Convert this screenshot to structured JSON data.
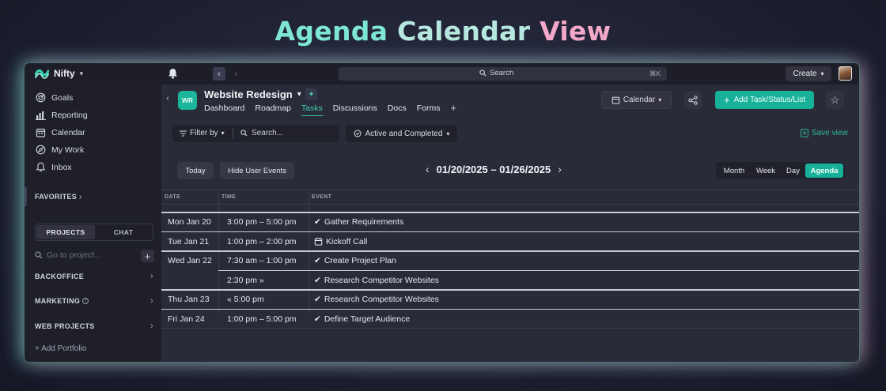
{
  "hero": {
    "word1": "Agenda",
    "word2": "Calendar",
    "word3": "View"
  },
  "topbar": {
    "brand": "Nifty",
    "search_label": "Search",
    "search_shortcut": "⌘K",
    "create_label": "Create"
  },
  "sidebar": {
    "nav": [
      {
        "label": "Goals",
        "icon": "goals-icon"
      },
      {
        "label": "Reporting",
        "icon": "chart-icon"
      },
      {
        "label": "Calendar",
        "icon": "calendar-icon"
      },
      {
        "label": "My Work",
        "icon": "compass-icon"
      },
      {
        "label": "Inbox",
        "icon": "bell-icon"
      }
    ],
    "favorites": "FAVORITES",
    "tab_projects": "PROJECTS",
    "tab_chat": "CHAT",
    "goto_placeholder": "Go to project...",
    "groups": [
      "BACKOFFICE",
      "MARKETING",
      "WEB PROJECTS"
    ],
    "add_portfolio": "+ Add Portfolio"
  },
  "project": {
    "badge": "WR",
    "title": "Website Redesign",
    "tabs": [
      "Dashboard",
      "Roadmap",
      "Tasks",
      "Discussions",
      "Docs",
      "Forms"
    ],
    "active_tab": "Tasks",
    "view_label": "Calendar",
    "add_task_label": "Add Task/Status/List"
  },
  "toolbar": {
    "filter_label": "Filter by",
    "search_placeholder": "Search...",
    "status_filter": "Active and Completed",
    "save_view": "Save view",
    "today": "Today",
    "hide_user_events": "Hide User Events",
    "date_range": "01/20/2025 – 01/26/2025",
    "views": [
      "Month",
      "Week",
      "Day",
      "Agenda"
    ],
    "active_view": "Agenda"
  },
  "agenda": {
    "headers": {
      "date": "DATE",
      "time": "TIME",
      "event": "EVENT"
    },
    "rows": [
      {
        "date": "Mon Jan 20",
        "time": "3:00 pm – 5:00 pm",
        "event": "Gather Requirements",
        "icon": "check-icon"
      },
      {
        "date": "Tue Jan 21",
        "time": "1:00 pm – 2:00 pm",
        "event": "Kickoff Call",
        "icon": "calendar-icon"
      },
      {
        "date": "Wed Jan 22",
        "time": "7:30 am – 1:00 pm",
        "event": "Create Project Plan",
        "icon": "check-icon"
      },
      {
        "date": "",
        "time": "2:30 pm »",
        "event": "Research Competitor Websites",
        "icon": "check-icon"
      },
      {
        "date": "Thu Jan 23",
        "time": "« 5:00 pm",
        "event": "Research Competitor Websites",
        "icon": "check-icon"
      },
      {
        "date": "Fri Jan 24",
        "time": "1:00 pm – 5:00 pm",
        "event": "Define Target Audience",
        "icon": "check-icon"
      }
    ]
  },
  "colors": {
    "accent": "#17b19a",
    "background": "#23242f",
    "sidebar": "#1e1f29"
  }
}
